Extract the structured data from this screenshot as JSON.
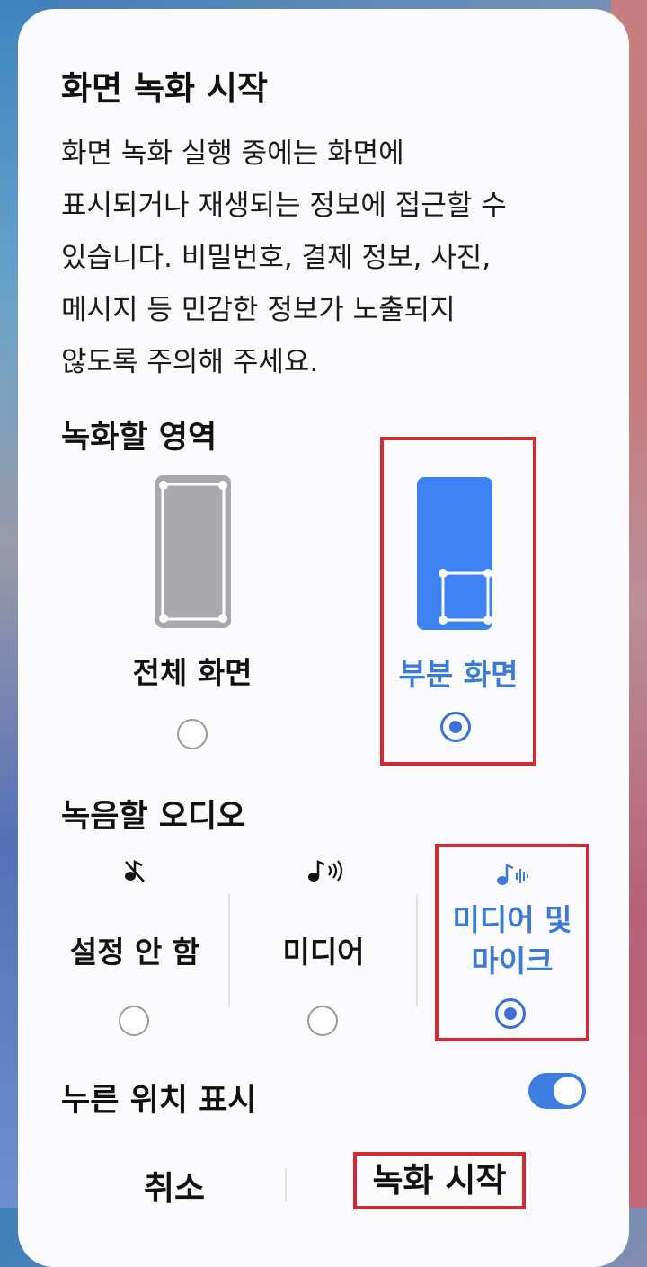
{
  "dialog": {
    "title": "화면 녹화 시작",
    "description_lines": [
      "화면 녹화 실행 중에는 화면에",
      "표시되거나 재생되는 정보에 접근할 수",
      "있습니다. 비밀번호, 결제 정보, 사진,",
      "메시지 등 민감한 정보가 노출되지",
      "않도록 주의해 주세요."
    ]
  },
  "record_area": {
    "heading": "녹화할 영역",
    "options": [
      {
        "label": "전체 화면",
        "selected": false,
        "icon": "full-screen-icon"
      },
      {
        "label": "부분 화면",
        "selected": true,
        "icon": "partial-screen-icon"
      }
    ]
  },
  "audio": {
    "heading": "녹음할 오디오",
    "options": [
      {
        "label": "설정 안 함",
        "selected": false,
        "icon": "sound-off-icon"
      },
      {
        "label": "미디어",
        "selected": false,
        "icon": "media-sound-icon"
      },
      {
        "label_line1": "미디어 및",
        "label_line2": "마이크",
        "selected": true,
        "icon": "media-mic-icon"
      }
    ]
  },
  "touch": {
    "label": "누른 위치 표시",
    "enabled": true
  },
  "buttons": {
    "cancel": "취소",
    "start": "녹화 시작"
  },
  "colors": {
    "accent": "#3b7bd8",
    "highlight": "#d42a34",
    "toggle_on": "#3d7de0"
  }
}
